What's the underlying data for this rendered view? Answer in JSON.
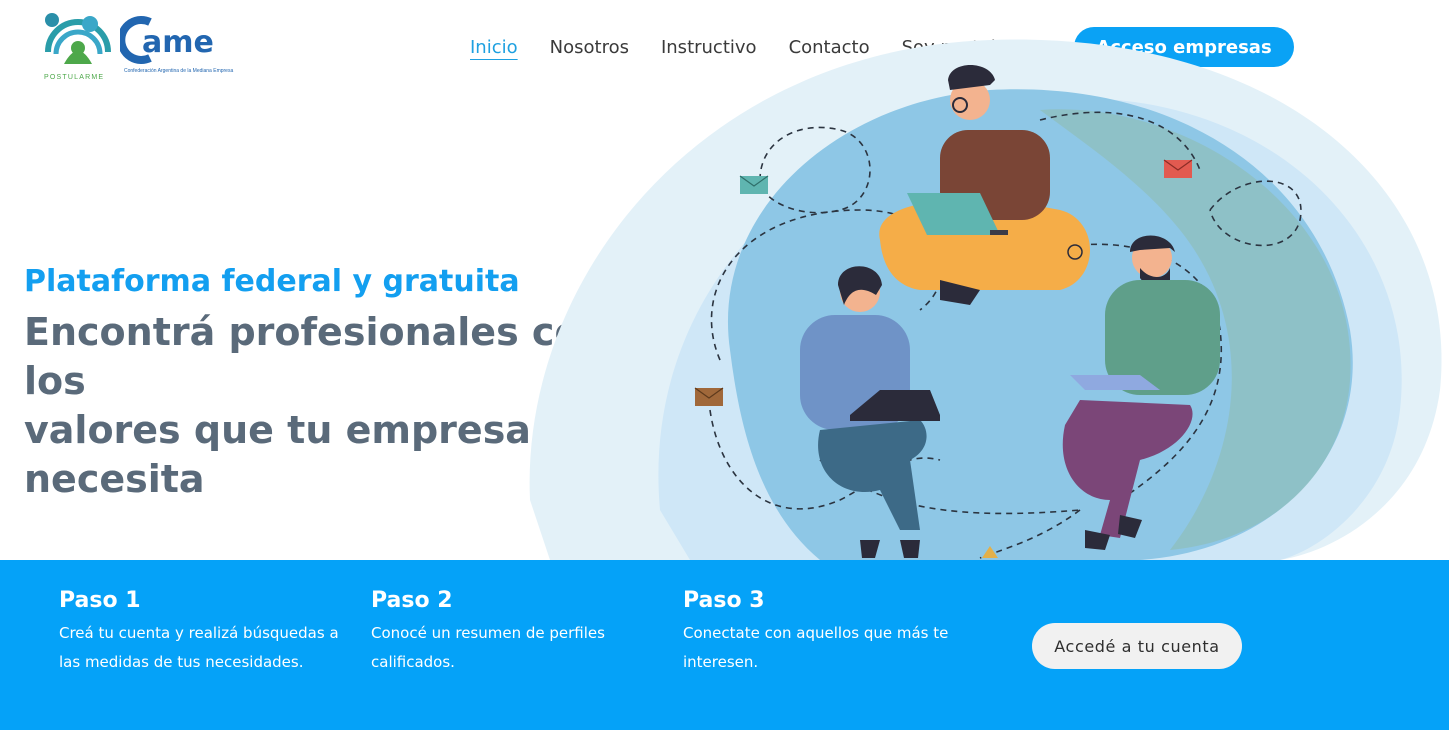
{
  "brand": {
    "postularme_caption": "POSTULARME",
    "came_wordmark": "ame",
    "came_subtitle": "Confederación Argentina de la Mediana Empresa"
  },
  "nav": {
    "items": [
      {
        "label": "Inicio",
        "active": true
      },
      {
        "label": "Nosotros"
      },
      {
        "label": "Instructivo"
      },
      {
        "label": "Contacto"
      },
      {
        "label": "Soy postulante"
      }
    ],
    "cta_label": "Acceso empresas"
  },
  "hero": {
    "eyebrow": "Plataforma federal y gratuita",
    "headline_line1": "Encontrá profesionales con los",
    "headline_line2": "valores que tu empresa necesita"
  },
  "steps": [
    {
      "title": "Paso 1",
      "line1": "Creá tu cuenta y realizá búsquedas a",
      "line2": "las medidas de tus necesidades."
    },
    {
      "title": "Paso 2",
      "line1": "Conocé un resumen de perfiles",
      "line2": "calificados."
    },
    {
      "title": "Paso 3",
      "line1": "Conectate con aquellos que más te",
      "line2": "interesen."
    }
  ],
  "account_button": "Accedé a tu cuenta",
  "colors": {
    "accent": "#0aa2f5",
    "band": "#05a2f8",
    "headline": "#5a6a7a"
  }
}
